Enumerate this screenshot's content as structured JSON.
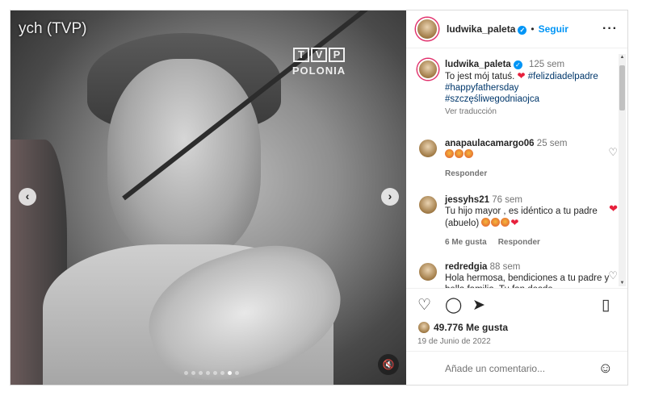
{
  "media": {
    "caption_overlay": "ych (TVP)",
    "logo_letters": [
      "T",
      "V",
      "P"
    ],
    "logo_sub": "POLONIA",
    "prev_glyph": "‹",
    "next_glyph": "›",
    "mute_icon": "🔇",
    "carousel_count": 8,
    "carousel_active": 6
  },
  "header": {
    "username": "ludwika_paleta",
    "verified_glyph": "✓",
    "separator": "•",
    "follow_label": "Seguir",
    "more_glyph": "···"
  },
  "caption": {
    "username": "ludwika_paleta",
    "time": "125 sem",
    "text": "To jest mój tatuś.",
    "heart": "❤",
    "tags": [
      "#felizdiadelpadre",
      "#happyfathersday",
      "#szczęśliwegodniaojca"
    ],
    "translate": "Ver traducción"
  },
  "comments": [
    {
      "username": "anapaulacamargo06",
      "time": "25 sem",
      "reply": "Responder",
      "liked": false
    },
    {
      "username": "jessyhs21",
      "time": "76 sem",
      "text": "Tu hijo mayor , es idéntico a tu padre (abuelo)",
      "likes": "6 Me gusta",
      "reply": "Responder",
      "liked": true
    },
    {
      "username": "redredgia",
      "time": "88 sem",
      "text": "Hola hermosa, bendiciones a tu padre y bella familia. Tu fan desde",
      "liked": false
    }
  ],
  "actions": {
    "like_icon": "♡",
    "comment_icon": "◯",
    "share_icon": "➤",
    "save_icon": "▯",
    "likes_count": "49.776 Me gusta",
    "date": "19 de Junio de 2022"
  },
  "composer": {
    "placeholder": "Añade un comentario...",
    "emoji_icon": "☺"
  }
}
